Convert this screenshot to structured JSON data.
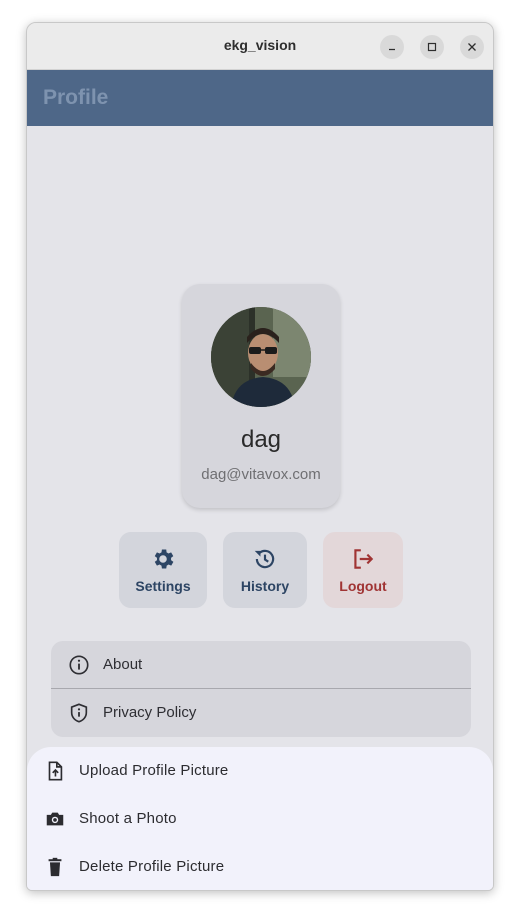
{
  "window": {
    "title": "ekg_vision"
  },
  "appbar": {
    "title": "Profile"
  },
  "profile": {
    "name": "dag",
    "email": "dag@vitavox.com"
  },
  "actions": [
    {
      "label": "Settings",
      "icon": "gear-icon"
    },
    {
      "label": "History",
      "icon": "history-icon"
    },
    {
      "label": "Logout",
      "icon": "logout-icon"
    }
  ],
  "menu": [
    {
      "label": "About",
      "icon": "info-icon"
    },
    {
      "label": "Privacy Policy",
      "icon": "shield-icon"
    }
  ],
  "sheet": [
    {
      "label": "Upload Profile Picture",
      "icon": "file-upload-icon"
    },
    {
      "label": "Shoot a Photo",
      "icon": "camera-icon"
    },
    {
      "label": "Delete Profile Picture",
      "icon": "trash-icon"
    }
  ],
  "colors": {
    "appbar": "#4e6788",
    "accent": "#2d4564",
    "logout": "#a03434",
    "sheet": "#f2f2fb"
  }
}
